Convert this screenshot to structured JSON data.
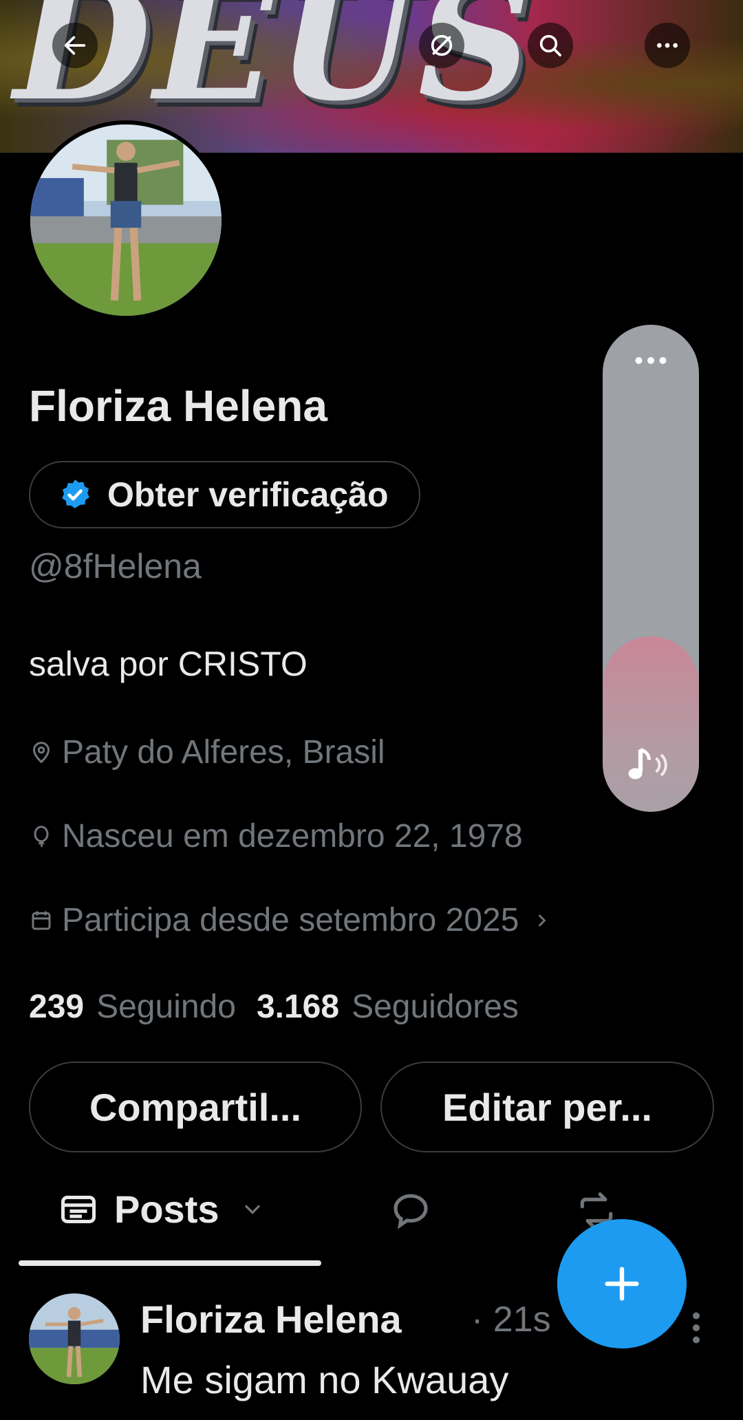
{
  "banner": {
    "word": "DEUS"
  },
  "profile": {
    "name": "Floriza Helena",
    "verify_label": "Obter verificação",
    "handle": "@8fHelena",
    "bio": "salva por CRISTO",
    "location": "Paty do Alferes, Brasil",
    "birthday": "Nasceu em dezembro 22, 1978",
    "joined": "Participa desde setembro 2025",
    "following_count": "239",
    "following_label": "Seguindo",
    "followers_count": "3.168",
    "followers_label": "Seguidores"
  },
  "actions": {
    "share_label": "Compartil...",
    "edit_label": "Editar per..."
  },
  "tabs": {
    "posts_label": "Posts"
  },
  "post": {
    "author": "Floriza Helena",
    "time": "· 21s",
    "text": "Me sigam no Kwauay"
  },
  "music_widget": {
    "level": 0.36
  },
  "colors": {
    "accent": "#1d9bf0",
    "background": "#000000",
    "text_primary": "#e7e9ea",
    "text_secondary": "#71767b",
    "border": "#3a3d40"
  },
  "icons": {
    "back": "arrow-left-icon",
    "grok": "grok-icon",
    "search": "search-icon",
    "more": "more-horizontal-icon",
    "verified": "verified-badge-icon",
    "location": "location-pin-icon",
    "birthday": "balloon-icon",
    "calendar": "calendar-icon",
    "compose": "plus-icon"
  }
}
